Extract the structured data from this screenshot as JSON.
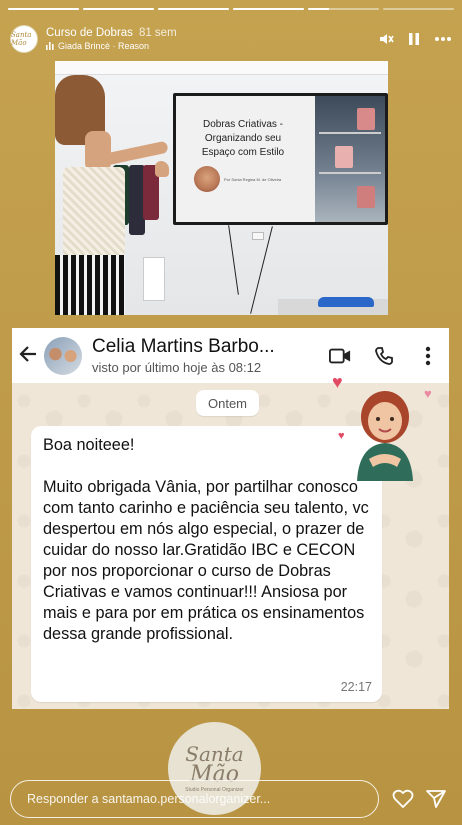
{
  "story": {
    "progress": [
      1,
      1,
      1,
      1,
      0.3,
      0
    ],
    "account_name": "Curso de Dobras",
    "time_ago": "81 sem",
    "music": "Giada Brincè · Reason",
    "avatar_text": "Santa Mão",
    "icons": [
      "mute-icon",
      "pause-icon",
      "more-icon"
    ]
  },
  "photo": {
    "slide_title": "Dobras Criativas - Organizando seu Espaço com Estilo",
    "slide_byline": "Por Sonia Regina M. de Oliveira"
  },
  "whatsapp": {
    "contact_name": "Celia Martins Barbo...",
    "last_seen": "visto por último hoje às 08:12",
    "date_separator": "Ontem",
    "message_greeting": "Boa noiteee!",
    "message_body": "Muito obrigada Vânia, por partilhar conosco com tanto carinho e paciência seu talento, vc despertou em nós algo especial, o prazer de cuidar do nosso lar.Gratidão IBC e CECON por nos proporcionar o curso de Dobras Criativas e vamos continuar!!! Ansiosa por mais e para por em prática os ensinamentos dessa grande profissional.",
    "message_time": "22:17"
  },
  "logo": {
    "line1": "Santa",
    "line2": "Mão",
    "line3": "Studio Personal Organizer"
  },
  "reply": {
    "placeholder": "Responder a santamao.personalorganizer..."
  },
  "colors": {
    "background": "#c5a24f",
    "heart": "#e04a63",
    "wa_chat_bg": "#efe6d8"
  }
}
